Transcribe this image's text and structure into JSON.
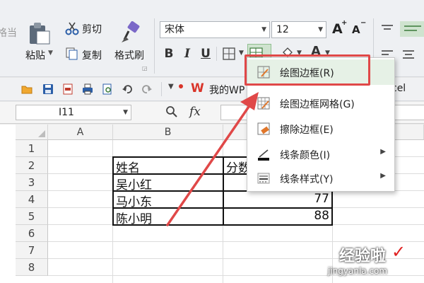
{
  "ribbon": {
    "left_partial_label": "格当",
    "clipboard": {
      "paste": "粘贴",
      "cut": "剪切",
      "copy": "复制",
      "format_painter": "格式刷"
    },
    "font_name": "宋体",
    "font_size": "12",
    "increase_font": "A",
    "decrease_font": "A",
    "bold": "B",
    "italic": "I",
    "underline": "U",
    "font_color_glyph": "A"
  },
  "quick_access": {
    "wps_label": "我的WP",
    "right_partial": "cel"
  },
  "formula_bar": {
    "cell_ref": "I11",
    "fx": "fx"
  },
  "grid": {
    "columns": [
      "A",
      "B"
    ],
    "rows": [
      "1",
      "2",
      "3",
      "4",
      "5",
      "6",
      "7",
      "8"
    ],
    "cells": {
      "b2": "姓名",
      "c2_partial": "分数",
      "b3": "吴小红",
      "b4": "马小东",
      "b5": "陈小明",
      "c4": "77",
      "c5": "88"
    }
  },
  "border_menu": {
    "items": [
      {
        "label": "绘图边框(R)",
        "icon": "draw-border-icon"
      },
      {
        "label": "绘图边框网格(G)",
        "icon": "draw-border-grid-icon"
      },
      {
        "label": "擦除边框(E)",
        "icon": "erase-border-icon"
      },
      {
        "label": "线条颜色(I)",
        "icon": "line-color-icon"
      },
      {
        "label": "线条样式(Y)",
        "icon": "line-style-icon"
      }
    ]
  },
  "watermark": {
    "text": "经验啦",
    "url": "jingyanla.com"
  },
  "colors": {
    "annotation": "#e04848",
    "menu_highlight": "#e6f1e6",
    "font_color": "#e02020",
    "wps_red": "#d9352a"
  }
}
